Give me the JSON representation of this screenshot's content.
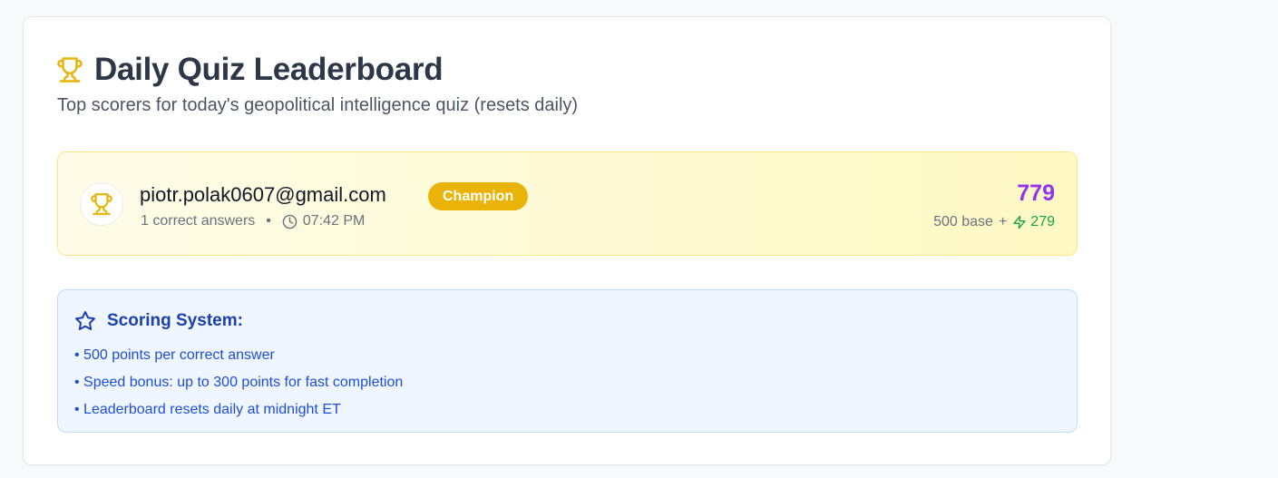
{
  "header": {
    "title": "Daily Quiz Leaderboard",
    "subtitle": "Top scorers for today's geopolitical intelligence quiz (resets daily)",
    "icon": "trophy-icon"
  },
  "leaderboard": [
    {
      "email": "piotr.polak0607@gmail.com",
      "badge": "Champion",
      "correct_answers": "1 correct answers",
      "separator": "•",
      "time": "07:42 PM",
      "score": "779",
      "base": "500 base",
      "plus": "+",
      "bonus": "279"
    }
  ],
  "scoring": {
    "title": "Scoring System:",
    "rules": [
      "500 points per correct answer",
      "Speed bonus: up to 300 points for fast completion",
      "Leaderboard resets daily at midnight ET"
    ]
  },
  "colors": {
    "accent_gold": "#eab308",
    "score_purple": "#9333ea",
    "bonus_green": "#16a34a",
    "info_blue": "#1e40af"
  }
}
